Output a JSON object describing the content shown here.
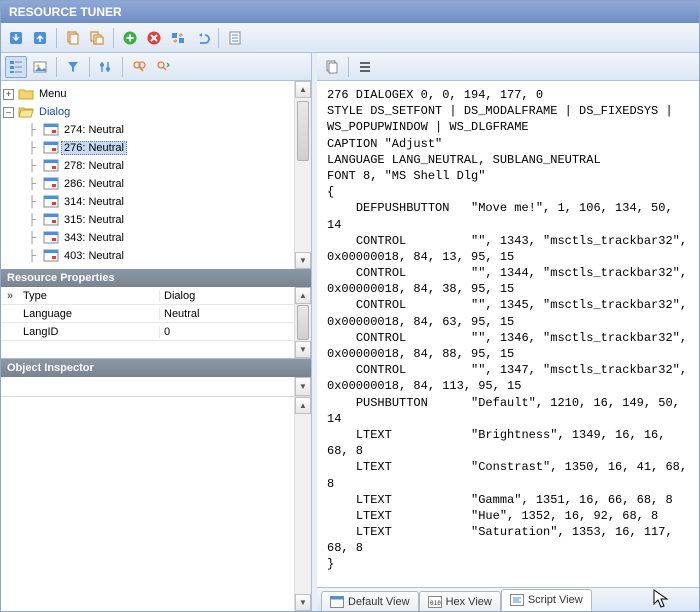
{
  "titlebar": "RESOURCE TUNER",
  "toolbar_main": {
    "down": "arrow-down",
    "up": "arrow-up",
    "copy1": "copy",
    "copy2": "copy-multi",
    "add": "add",
    "remove": "remove",
    "swap": "swap",
    "undo": "undo",
    "list": "list"
  },
  "left_toolbar": {
    "tree": "tree-view",
    "img": "image-view",
    "filter": "filter",
    "tune": "tune",
    "find": "find",
    "find_replace": "find-replace"
  },
  "right_toolbar": {
    "copy": "copy",
    "lines": "lines"
  },
  "tree": {
    "root1": {
      "label": "Menu",
      "expanded": false
    },
    "root2": {
      "label": "Dialog",
      "expanded": true,
      "items": [
        {
          "label": "274: Neutral"
        },
        {
          "label": "276: Neutral",
          "selected": true
        },
        {
          "label": "278: Neutral"
        },
        {
          "label": "286: Neutral"
        },
        {
          "label": "314: Neutral"
        },
        {
          "label": "315: Neutral"
        },
        {
          "label": "343: Neutral"
        },
        {
          "label": "403: Neutral"
        }
      ]
    }
  },
  "panels": {
    "resource_properties": "Resource Properties",
    "object_inspector": "Object Inspector"
  },
  "props": [
    {
      "key": "Type",
      "value": "Dialog"
    },
    {
      "key": "Language",
      "value": "Neutral"
    },
    {
      "key": "LangID",
      "value": "0"
    }
  ],
  "script": "276 DIALOGEX 0, 0, 194, 177, 0\nSTYLE DS_SETFONT | DS_MODALFRAME | DS_FIXEDSYS | WS_POPUPWINDOW | WS_DLGFRAME\nCAPTION \"Adjust\"\nLANGUAGE LANG_NEUTRAL, SUBLANG_NEUTRAL\nFONT 8, \"MS Shell Dlg\"\n{\n    DEFPUSHBUTTON   \"Move me!\", 1, 106, 134, 50, 14\n    CONTROL         \"\", 1343, \"msctls_trackbar32\", 0x00000018, 84, 13, 95, 15\n    CONTROL         \"\", 1344, \"msctls_trackbar32\", 0x00000018, 84, 38, 95, 15\n    CONTROL         \"\", 1345, \"msctls_trackbar32\", 0x00000018, 84, 63, 95, 15\n    CONTROL         \"\", 1346, \"msctls_trackbar32\", 0x00000018, 84, 88, 95, 15\n    CONTROL         \"\", 1347, \"msctls_trackbar32\", 0x00000018, 84, 113, 95, 15\n    PUSHBUTTON      \"Default\", 1210, 16, 149, 50, 14\n    LTEXT           \"Brightness\", 1349, 16, 16, 68, 8\n    LTEXT           \"Constrast\", 1350, 16, 41, 68, 8\n    LTEXT           \"Gamma\", 1351, 16, 66, 68, 8\n    LTEXT           \"Hue\", 1352, 16, 92, 68, 8\n    LTEXT           \"Saturation\", 1353, 16, 117, 68, 8\n}",
  "tabs": {
    "default": "Default View",
    "hex": "Hex View",
    "script": "Script View"
  }
}
